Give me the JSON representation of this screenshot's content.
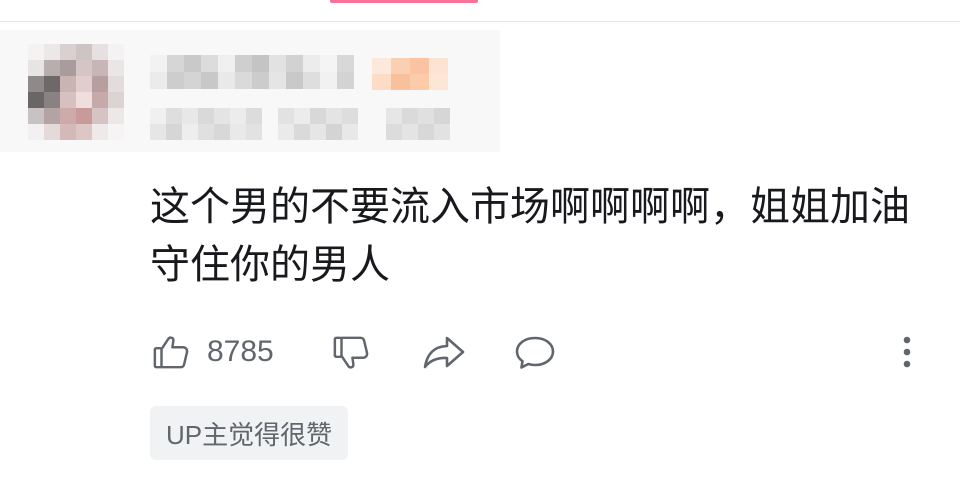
{
  "colors": {
    "accent": "#fb7299",
    "text": "#18191c",
    "muted": "#61666d",
    "badge_bg": "#f1f2f3",
    "divider": "#e3e5e7"
  },
  "comment": {
    "content": "这个男的不要流入市场啊啊啊啊，姐姐加油守住你的男人",
    "like_count": "8785",
    "up_badge": "UP主觉得很赞"
  },
  "actions": {
    "like_icon": "thumbs-up-icon",
    "dislike_icon": "thumbs-down-icon",
    "share_icon": "share-arrow-icon",
    "reply_icon": "comment-bubble-icon",
    "more_icon": "more-vertical-icon"
  }
}
